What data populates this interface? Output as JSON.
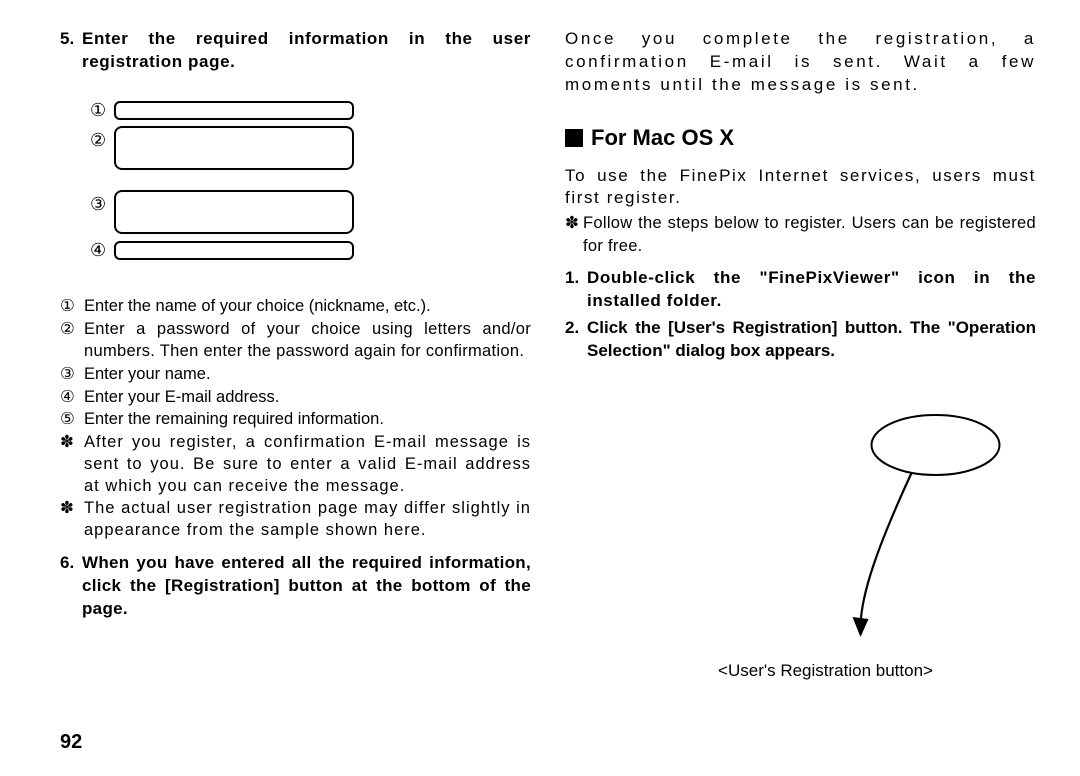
{
  "left": {
    "step5": {
      "num": "5.",
      "text": "Enter the required information in the user registration page."
    },
    "fig_labels": [
      "①",
      "②",
      "③",
      "④"
    ],
    "legend": [
      {
        "mark": "①",
        "text": "Enter the name of your choice (nickname, etc.)."
      },
      {
        "mark": "②",
        "text": "Enter a password of your choice using letters and/or numbers. Then enter the password again for confirmation."
      },
      {
        "mark": "③",
        "text": "Enter your name."
      },
      {
        "mark": "④",
        "text": "Enter your E-mail address."
      },
      {
        "mark": "⑤",
        "text": "Enter the remaining required information."
      },
      {
        "mark": "✽",
        "text": "After you register, a confirmation E-mail message is sent to you. Be sure to enter a valid E-mail address at which you can receive the message."
      },
      {
        "mark": "✽",
        "text": "The actual user registration page may differ slightly in appearance from the sample shown here."
      }
    ],
    "step6": {
      "num": "6.",
      "text": "When you have entered all the required information, click the [Registration] button at the bottom of the page."
    }
  },
  "right": {
    "top_para": "Once you complete the registration, a confirmation E-mail is sent. Wait a few moments until the message is sent.",
    "heading": "For Mac OS X",
    "intro": "To use the FinePix Internet services, users must first register.",
    "follow": {
      "mark": "✽",
      "text": "Follow the steps below to register. Users can be registered for free."
    },
    "step1": {
      "num": "1.",
      "text": "Double-click the \"FinePixViewer\" icon in the installed folder."
    },
    "step2": {
      "num": "2.",
      "text": "Click the [User's Registration] button. The \"Operation Selection\" dialog box appears."
    },
    "caption": "<User's Registration button>"
  },
  "page_number": "92"
}
